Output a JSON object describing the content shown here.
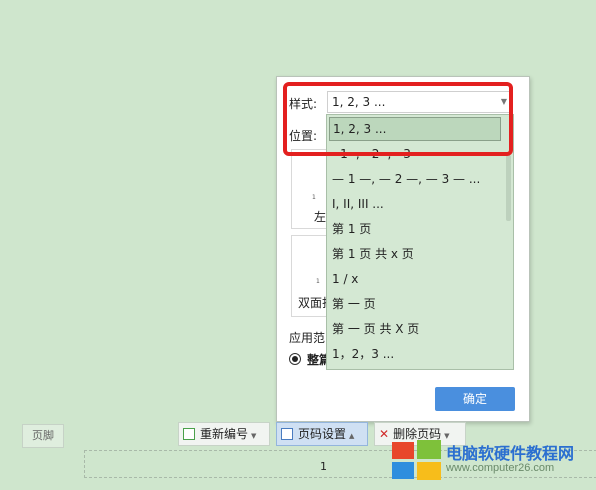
{
  "panel": {
    "style_label": "样式:",
    "style_value": "1, 2, 3 ...",
    "position_label": "位置:",
    "preview_left_label": "左",
    "preview_double_label": "双面打",
    "apply_label": "应用范",
    "apply_option": "整篇",
    "ok_label": "确定"
  },
  "dropdown": {
    "options": [
      "1, 2, 3 ...",
      "- 1 -, - 2 -, - 3 -",
      "— 1 —, — 2 —, — 3 — ...",
      "I, II, III ...",
      "第 1 页",
      "第 1 页 共 x 页",
      "1 / x",
      "第 一 页",
      "第 一 页 共 X 页",
      "1，2，3 ..."
    ]
  },
  "toolbar": {
    "footer_tag": "页脚",
    "renumber_label": "重新编号",
    "page_setting_label": "页码设置",
    "delete_label": "删除页码"
  },
  "page": {
    "number": "1"
  },
  "watermark": {
    "title": "电脑软硬件教程网",
    "url": "www.computer26.com"
  },
  "colors": {
    "accent": "#4a8fde",
    "highlight": "#e3201f",
    "background": "#cfe6cd"
  }
}
